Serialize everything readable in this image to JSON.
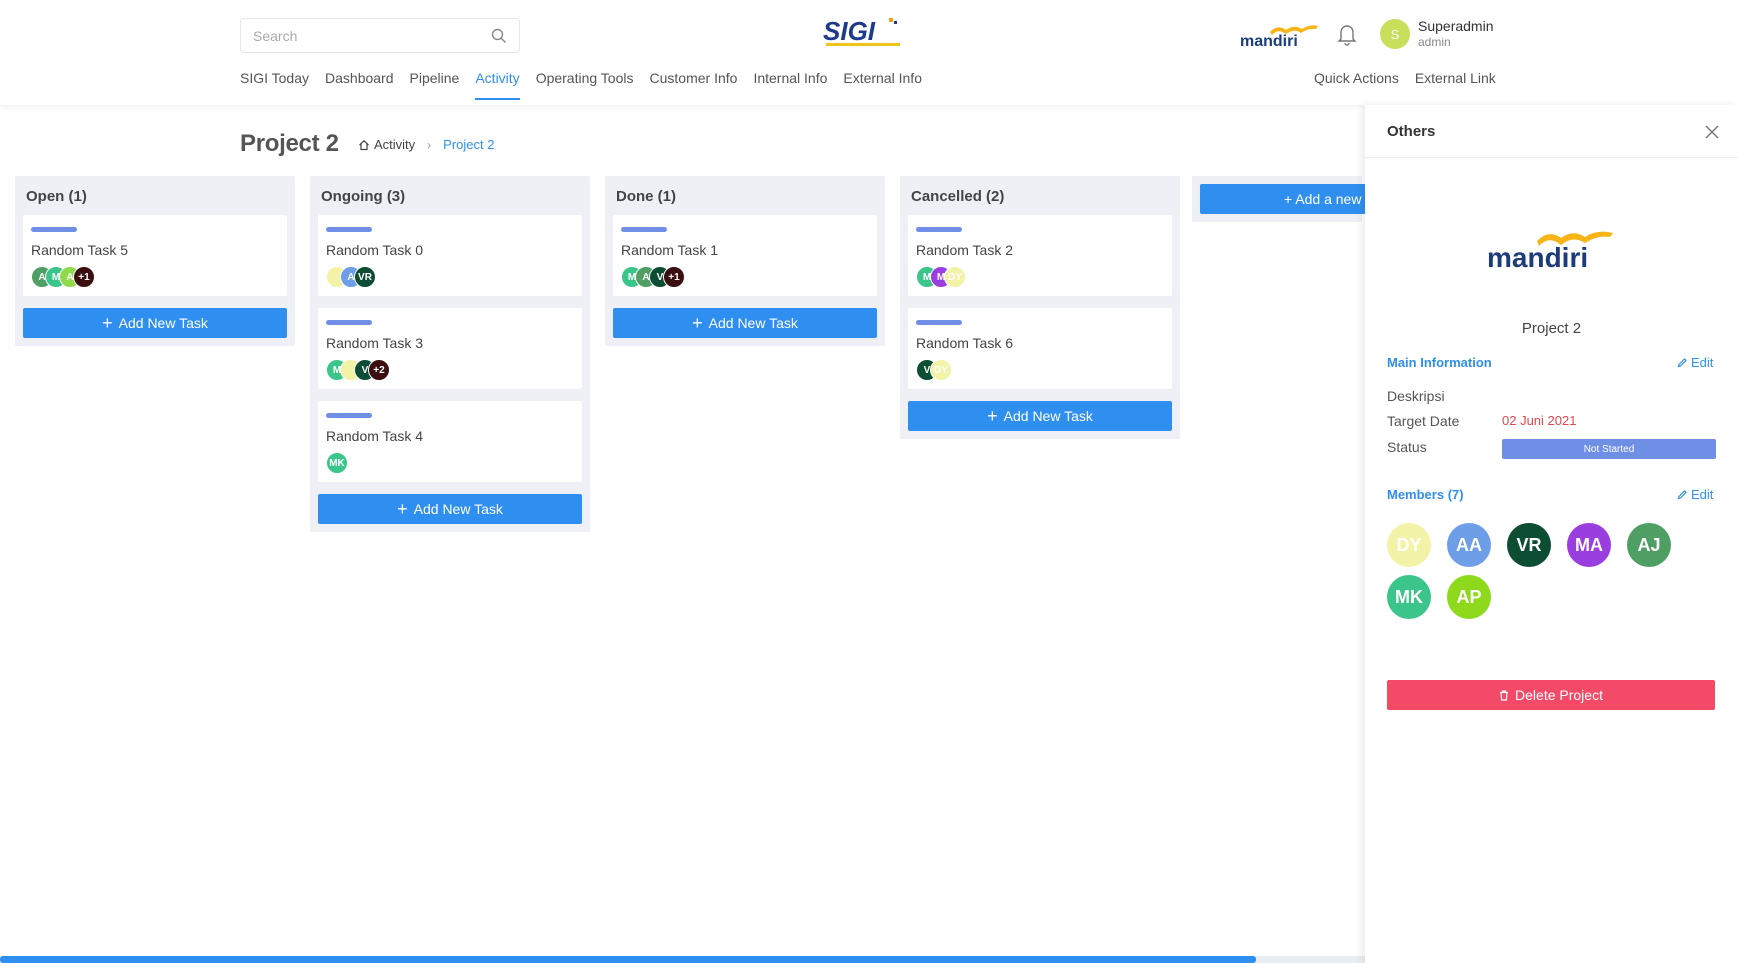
{
  "header": {
    "search_placeholder": "Search",
    "logo_text": "SIGI",
    "bank_logo": "mandiri",
    "user": {
      "initial": "S",
      "name": "Superadmin",
      "role": "admin"
    },
    "nav": [
      "SIGI Today",
      "Dashboard",
      "Pipeline",
      "Activity",
      "Operating Tools",
      "Customer Info",
      "Internal Info",
      "External Info"
    ],
    "nav_active": "Activity",
    "nav_right": [
      "Quick Actions",
      "External Link"
    ]
  },
  "page": {
    "title": "Project 2",
    "breadcrumb_home": "Activity",
    "breadcrumb_current": "Project 2"
  },
  "board": {
    "add_task_label": "Add New Task",
    "add_stage_label": "+ Add a new s",
    "columns": [
      {
        "title": "Open (1)",
        "cards": [
          {
            "name": "Random Task 5",
            "avatars": [
              {
                "t": "A",
                "c": "#4f9e64"
              },
              {
                "t": "M",
                "c": "#3bc58a"
              },
              {
                "t": "A",
                "c": "#8fd94a"
              },
              {
                "t": "+1",
                "c": "#3b0f0f"
              }
            ]
          }
        ]
      },
      {
        "title": "Ongoing (3)",
        "cards": [
          {
            "name": "Random Task 0",
            "avatars": [
              {
                "t": "",
                "c": "#f3f3a8"
              },
              {
                "t": "A",
                "c": "#6f9ee8"
              },
              {
                "t": "VR",
                "c": "#0d4d34"
              }
            ]
          },
          {
            "name": "Random Task 3",
            "avatars": [
              {
                "t": "M",
                "c": "#3bc58a"
              },
              {
                "t": "",
                "c": "#f3f3a8"
              },
              {
                "t": "V",
                "c": "#0d4d34"
              },
              {
                "t": "+2",
                "c": "#3b0f0f"
              }
            ]
          },
          {
            "name": "Random Task 4",
            "avatars": [
              {
                "t": "MK",
                "c": "#3bc58a"
              }
            ]
          }
        ]
      },
      {
        "title": "Done (1)",
        "cards": [
          {
            "name": "Random Task 1",
            "avatars": [
              {
                "t": "M",
                "c": "#3bc58a"
              },
              {
                "t": "A",
                "c": "#4f9e64"
              },
              {
                "t": "V",
                "c": "#0d4d34"
              },
              {
                "t": "+1",
                "c": "#3b0f0f"
              }
            ]
          }
        ]
      },
      {
        "title": "Cancelled (2)",
        "cards": [
          {
            "name": "Random Task 2",
            "avatars": [
              {
                "t": "M",
                "c": "#3bc58a"
              },
              {
                "t": "M",
                "c": "#9b3ee0"
              },
              {
                "t": "DY",
                "c": "#f3f3a8"
              }
            ]
          },
          {
            "name": "Random Task 6",
            "avatars": [
              {
                "t": "V",
                "c": "#0d4d34"
              },
              {
                "t": "DY",
                "c": "#f3f3a8"
              }
            ]
          }
        ]
      }
    ]
  },
  "panel": {
    "title": "Others",
    "bank_logo": "mandiri",
    "project_name": "Project 2",
    "main_info_title": "Main Information",
    "edit_label": "Edit",
    "fields": {
      "deskripsi_label": "Deskripsi",
      "target_date_label": "Target Date",
      "target_date_value": "02 Juni 2021",
      "status_label": "Status",
      "status_value": "Not Started"
    },
    "members_title": "Members (7)",
    "members": [
      {
        "t": "DY",
        "c": "#f3f3a8"
      },
      {
        "t": "AA",
        "c": "#6f9ee8"
      },
      {
        "t": "VR",
        "c": "#0d4d34"
      },
      {
        "t": "MA",
        "c": "#9b3ee0"
      },
      {
        "t": "AJ",
        "c": "#4f9e64"
      },
      {
        "t": "MK",
        "c": "#3bc58a"
      },
      {
        "t": "AP",
        "c": "#8fd91c"
      }
    ],
    "delete_label": "Delete Project"
  },
  "colors": {
    "accent": "#2f8ff0",
    "danger": "#f24a67",
    "status": "#6f8fe6",
    "date": "#e4454f"
  },
  "scroll": {
    "fraction": 0.92
  }
}
